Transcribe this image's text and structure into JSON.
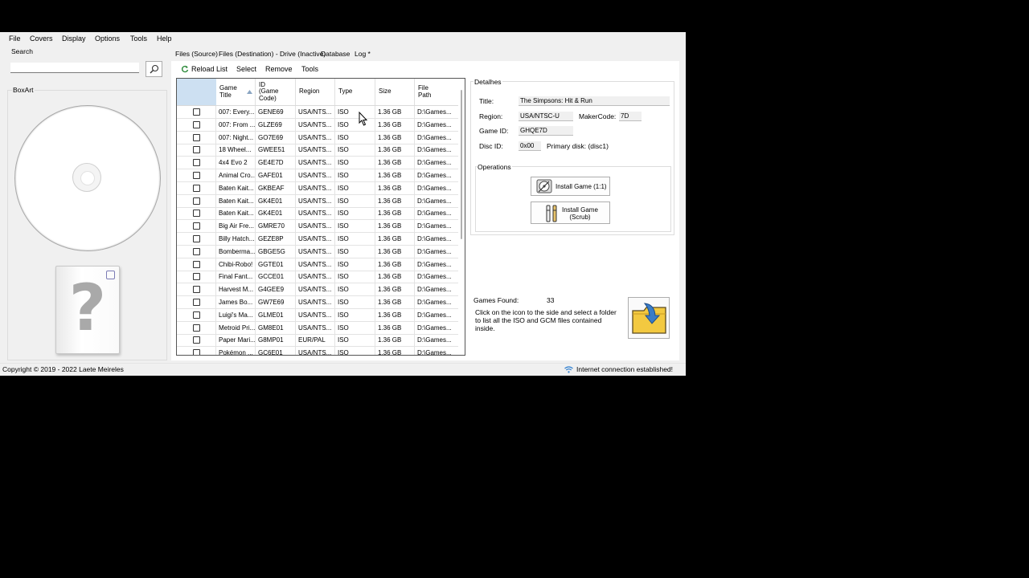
{
  "menu": [
    "File",
    "Covers",
    "Display",
    "Options",
    "Tools",
    "Help"
  ],
  "left": {
    "search_label": "Search",
    "search_value": "",
    "boxart_label": "BoxArt",
    "cover_placeholder": "?"
  },
  "tabs": [
    "Files (Source)",
    "Files (Destination) - Drive (Inactive)",
    "Database",
    "Log *"
  ],
  "toolbar": {
    "reload": "Reload List",
    "select": "Select",
    "remove": "Remove",
    "tools": "Tools"
  },
  "grid": {
    "columns": [
      "Game Title",
      "ID (Game Code)",
      "Region",
      "Type",
      "Size",
      "File Path"
    ],
    "rows": [
      {
        "title": "007: Every...",
        "id": "GENE69",
        "region": "USA/NTS...",
        "type": "ISO",
        "size": "1.36 GB",
        "path": "D:\\Games..."
      },
      {
        "title": "007: From ...",
        "id": "GLZE69",
        "region": "USA/NTS...",
        "type": "ISO",
        "size": "1.36 GB",
        "path": "D:\\Games..."
      },
      {
        "title": "007: Night...",
        "id": "GO7E69",
        "region": "USA/NTS...",
        "type": "ISO",
        "size": "1.36 GB",
        "path": "D:\\Games..."
      },
      {
        "title": "18 Wheel...",
        "id": "GWEE51",
        "region": "USA/NTS...",
        "type": "ISO",
        "size": "1.36 GB",
        "path": "D:\\Games..."
      },
      {
        "title": "4x4 Evo 2",
        "id": "GE4E7D",
        "region": "USA/NTS...",
        "type": "ISO",
        "size": "1.36 GB",
        "path": "D:\\Games..."
      },
      {
        "title": "Animal Cro...",
        "id": "GAFE01",
        "region": "USA/NTS...",
        "type": "ISO",
        "size": "1.36 GB",
        "path": "D:\\Games..."
      },
      {
        "title": "Baten Kait...",
        "id": "GKBEAF",
        "region": "USA/NTS...",
        "type": "ISO",
        "size": "1.36 GB",
        "path": "D:\\Games..."
      },
      {
        "title": "Baten Kait...",
        "id": "GK4E01",
        "region": "USA/NTS...",
        "type": "ISO",
        "size": "1.36 GB",
        "path": "D:\\Games..."
      },
      {
        "title": "Baten Kait...",
        "id": "GK4E01",
        "region": "USA/NTS...",
        "type": "ISO",
        "size": "1.36 GB",
        "path": "D:\\Games..."
      },
      {
        "title": "Big Air Fre...",
        "id": "GMRE70",
        "region": "USA/NTS...",
        "type": "ISO",
        "size": "1.36 GB",
        "path": "D:\\Games..."
      },
      {
        "title": "Billy Hatch...",
        "id": "GEZE8P",
        "region": "USA/NTS...",
        "type": "ISO",
        "size": "1.36 GB",
        "path": "D:\\Games..."
      },
      {
        "title": "Bomberma...",
        "id": "GBGE5G",
        "region": "USA/NTS...",
        "type": "ISO",
        "size": "1.36 GB",
        "path": "D:\\Games..."
      },
      {
        "title": "Chibi-Robo!",
        "id": "GGTE01",
        "region": "USA/NTS...",
        "type": "ISO",
        "size": "1.36 GB",
        "path": "D:\\Games..."
      },
      {
        "title": "Final Fant...",
        "id": "GCCE01",
        "region": "USA/NTS...",
        "type": "ISO",
        "size": "1.36 GB",
        "path": "D:\\Games..."
      },
      {
        "title": "Harvest M...",
        "id": "G4GEE9",
        "region": "USA/NTS...",
        "type": "ISO",
        "size": "1.36 GB",
        "path": "D:\\Games..."
      },
      {
        "title": "James Bo...",
        "id": "GW7E69",
        "region": "USA/NTS...",
        "type": "ISO",
        "size": "1.36 GB",
        "path": "D:\\Games..."
      },
      {
        "title": "Luigi's Ma...",
        "id": "GLME01",
        "region": "USA/NTS...",
        "type": "ISO",
        "size": "1.36 GB",
        "path": "D:\\Games..."
      },
      {
        "title": "Metroid Pri...",
        "id": "GM8E01",
        "region": "USA/NTS...",
        "type": "ISO",
        "size": "1.36 GB",
        "path": "D:\\Games..."
      },
      {
        "title": "Paper Mari...",
        "id": "G8MP01",
        "region": "EUR/PAL",
        "type": "ISO",
        "size": "1.36 GB",
        "path": "D:\\Games..."
      },
      {
        "title": "Pokémon ...",
        "id": "GC6E01",
        "region": "USA/NTS...",
        "type": "ISO",
        "size": "1.36 GB",
        "path": "D:\\Games..."
      }
    ]
  },
  "details": {
    "group_label": "Detalhes",
    "title_label": "Title:",
    "title_value": "The Simpsons: Hit & Run",
    "region_label": "Region:",
    "region_value": "USA/NTSC-U",
    "maker_label": "MakerCode:",
    "maker_value": "7D",
    "gameid_label": "Game ID:",
    "gameid_value": "GHQE7D",
    "discid_label": "Disc ID:",
    "discid_value": "0x00",
    "primary_disk": "Primary disk: (disc1)"
  },
  "operations": {
    "group_label": "Operations",
    "install_1to1": "Install Game (1:1)",
    "install_scrub_1": "Install Game",
    "install_scrub_2": "(Scrub)"
  },
  "games_found": {
    "label": "Games Found:",
    "count": "33",
    "hint": "Click on the icon to the side and select a folder to list all the ISO and GCM files contained inside."
  },
  "status": {
    "copyright": "Copyright © 2019 - 2022 Laete Meireles",
    "connection": "Internet connection established!"
  }
}
